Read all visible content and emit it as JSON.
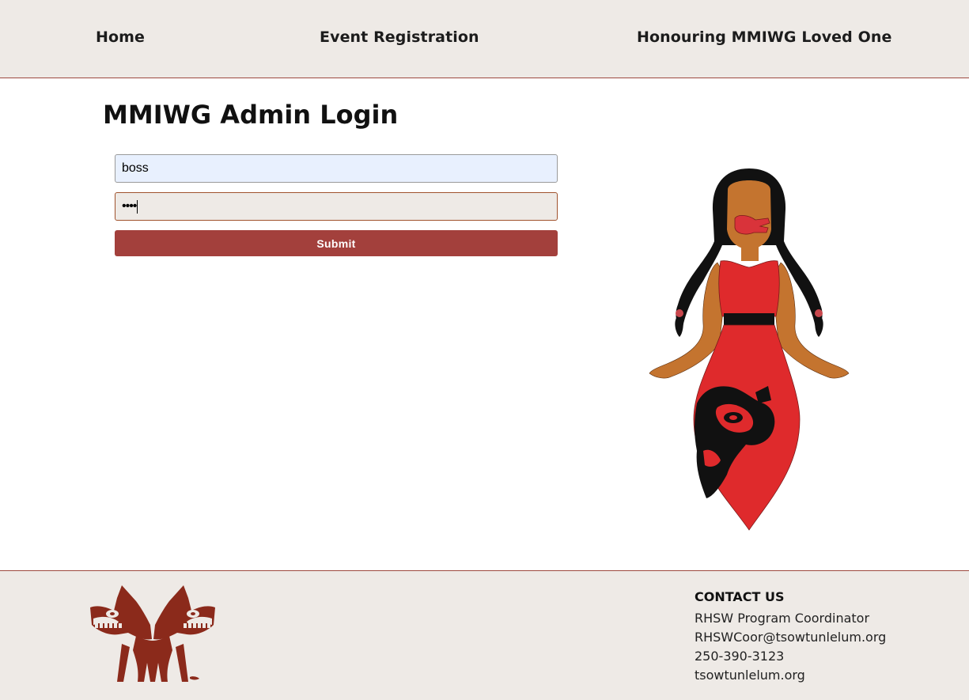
{
  "nav": {
    "home": "Home",
    "event_registration": "Event Registration",
    "honouring": "Honouring MMIWG Loved One"
  },
  "main": {
    "title": "MMIWG Admin Login",
    "username_value": "boss",
    "password_value": "••••",
    "submit_label": "Submit"
  },
  "footer": {
    "contact_heading": "CONTACT US",
    "contact_role": "RHSW Program Coordinator",
    "contact_email": "RHSWCoor@tsowtunlelum.org",
    "contact_phone": "250-390-3123",
    "contact_site": "tsowtunlelum.org"
  },
  "colors": {
    "nav_bg": "#eeeae6",
    "accent": "#a3403c",
    "logo": "#8b2a1b",
    "dress": "#df2a2c"
  },
  "icons": {
    "illustration": "indigenous-woman-red-dress-illustration",
    "logo": "twin-wolf-formline-logo"
  }
}
